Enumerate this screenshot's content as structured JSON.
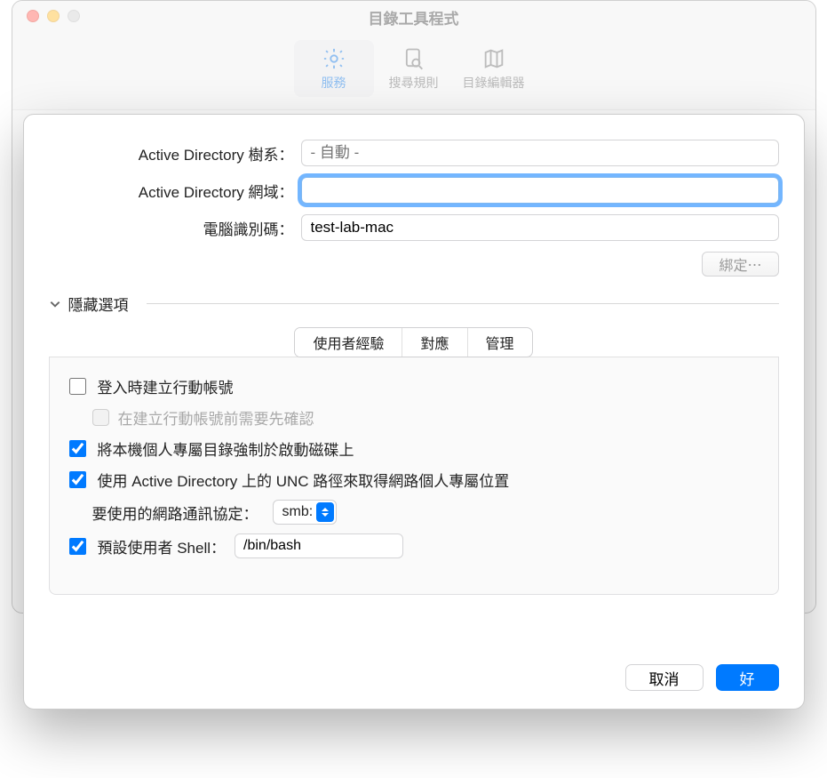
{
  "window": {
    "title": "目錄工具程式"
  },
  "toolbar": {
    "services": "服務",
    "search_policy": "搜尋規則",
    "directory_editor": "目錄編輯器"
  },
  "form": {
    "forest_label": "Active Directory 樹系：",
    "forest_placeholder": "- 自動 -",
    "domain_label": "Active Directory 網域：",
    "domain_value": "",
    "computer_id_label": "電腦識別碼：",
    "computer_id_value": "test-lab-mac",
    "bind_button": "綁定⋯"
  },
  "disclosure": {
    "label": "隱藏選項"
  },
  "tabs": {
    "ux": "使用者經驗",
    "mappings": "對應",
    "admin": "管理"
  },
  "opts": {
    "mobile_account": "登入時建立行動帳號",
    "confirm_before": "在建立行動帳號前需要先確認",
    "force_home": "將本機個人專屬目錄強制於啟動磁碟上",
    "unc_path": "使用 Active Directory 上的 UNC 路徑來取得網路個人專屬位置",
    "protocol_label": "要使用的網路通訊協定：",
    "protocol_value": "smb:",
    "shell_label": "預設使用者 Shell：",
    "shell_value": "/bin/bash"
  },
  "footer": {
    "cancel": "取消",
    "ok": "好"
  }
}
